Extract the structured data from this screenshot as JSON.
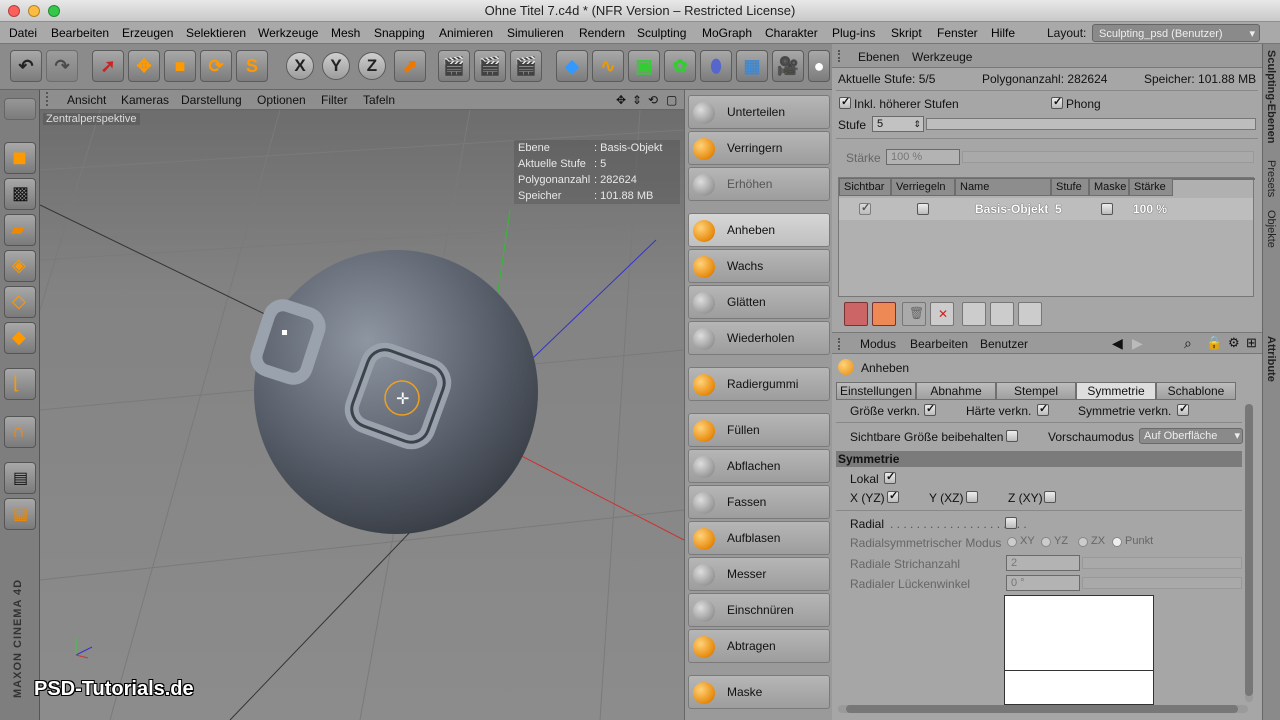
{
  "window": {
    "title": "Ohne Titel 7.c4d * (NFR Version – Restricted License)"
  },
  "menu": [
    "Datei",
    "Bearbeiten",
    "Erzeugen",
    "Selektieren",
    "Werkzeuge",
    "Mesh",
    "Snapping",
    "Animieren",
    "Simulieren",
    "Rendern",
    "Sculpting",
    "MoGraph",
    "Charakter",
    "Plug-ins",
    "Skript",
    "Fenster",
    "Hilfe"
  ],
  "layout": {
    "label": "Layout:",
    "value": "Sculpting_psd (Benutzer)"
  },
  "toolbar": {
    "axis_x": "X",
    "axis_y": "Y",
    "axis_z": "Z"
  },
  "viewport": {
    "menu": [
      "Ansicht",
      "Kameras",
      "Darstellung",
      "Optionen",
      "Filter",
      "Tafeln"
    ],
    "label": "Zentralperspektive",
    "hud": [
      {
        "k": "Ebene",
        "v": ": Basis-Objekt"
      },
      {
        "k": "Aktuelle Stufe",
        "v": ": 5"
      },
      {
        "k": "Polygonanzahl",
        "v": ": 282624"
      },
      {
        "k": "Speicher",
        "v": ": 101.88 MB"
      }
    ],
    "watermark": "PSD-Tutorials.de",
    "brand": "MAXON CINEMA 4D"
  },
  "brushes": [
    {
      "label": "Unterteilen",
      "state": "normal"
    },
    {
      "label": "Verringern",
      "state": "normal"
    },
    {
      "label": "Erhöhen",
      "state": "disabled"
    },
    {
      "label": "Anheben",
      "state": "selected"
    },
    {
      "label": "Wachs",
      "state": "normal"
    },
    {
      "label": "Glätten",
      "state": "normal"
    },
    {
      "label": "Wiederholen",
      "state": "normal"
    },
    {
      "label": "Radiergummi",
      "state": "normal"
    },
    {
      "label": "Füllen",
      "state": "normal"
    },
    {
      "label": "Abflachen",
      "state": "normal"
    },
    {
      "label": "Fassen",
      "state": "normal"
    },
    {
      "label": "Aufblasen",
      "state": "normal"
    },
    {
      "label": "Messer",
      "state": "normal"
    },
    {
      "label": "Einschnüren",
      "state": "normal"
    },
    {
      "label": "Abtragen",
      "state": "normal"
    },
    {
      "label": "Maske",
      "state": "normal"
    }
  ],
  "layers": {
    "tabs": [
      "Ebenen",
      "Werkzeuge"
    ],
    "aktuelle_stufe": "Aktuelle Stufe: 5/5",
    "polygonanzahl": "Polygonanzahl: 282624",
    "speicher": "Speicher: 101.88 MB",
    "inkl": "Inkl. höherer Stufen",
    "phong": "Phong",
    "stufe_label": "Stufe",
    "stufe_value": "5",
    "staerke_label": "Stärke",
    "staerke_value": "100 %",
    "columns": [
      "Sichtbar",
      "Verriegeln",
      "Name",
      "Stufe",
      "Maske",
      "Stärke"
    ],
    "row": {
      "name": "Basis-Objekt",
      "stufe": "5",
      "staerke": "100 %"
    }
  },
  "attr": {
    "menu": [
      "Modus",
      "Bearbeiten",
      "Benutzer"
    ],
    "tool": "Anheben",
    "tabs": [
      "Einstellungen",
      "Abnahme",
      "Stempel",
      "Symmetrie",
      "Schablone"
    ],
    "groesse": "Größe verkn.",
    "haerte": "Härte verkn.",
    "symmetrie_verkn": "Symmetrie verkn.",
    "sichtbare": "Sichtbare Größe beibehalten",
    "vorschau_label": "Vorschaumodus",
    "vorschau_value": "Auf Oberfläche",
    "section": "Symmetrie",
    "lokal": "Lokal",
    "x": "X (YZ)",
    "y": "Y (XZ)",
    "z": "Z (XY)",
    "radial": "Radial",
    "radial_modus": "Radialsymmetrischer Modus",
    "modes": [
      "XY",
      "YZ",
      "ZX",
      "Punkt"
    ],
    "strichanzahl": "Radiale Strichanzahl",
    "strichanzahl_value": "2",
    "lueckenwinkel": "Radialer Lückenwinkel",
    "lueckenwinkel_value": "0 °"
  },
  "side_tabs": [
    "Sculpting-Ebenen",
    "Presets",
    "Objekte",
    "Attribute"
  ]
}
